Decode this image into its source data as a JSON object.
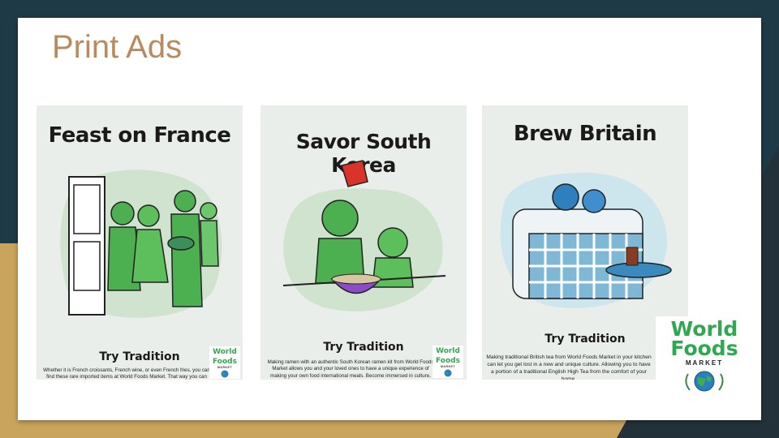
{
  "slide": {
    "title": "Print Ads"
  },
  "ads": [
    {
      "headline": "Feast on France",
      "subhead": "Try Tradition",
      "body": "Whether it is French croissants, French wine, or even French fries, you can find these rare imported items at World Foods Market. That way you can experience a Parisian family dinner without having to buy a plane ticket."
    },
    {
      "headline": "Savor South Korea",
      "subhead": "Try Tradition",
      "body": "Making ramen with an authentic South Korean ramen kit from World Foods Market allows you and your loved ones to have a unique experience of making your own food international meals. Become immersed in culture, without setting foot in South Korea."
    },
    {
      "headline": "Brew Britain",
      "subhead": "Try Tradition",
      "body": "Making traditional British tea from World Foods Market in your kitchen can let you get lost in a new and unique culture. Allowing you to have a portion of a traditional English High Tea from the comfort of your home."
    }
  ],
  "logo": {
    "word1": "World",
    "word2": "Foods",
    "tagline": "MARKET"
  },
  "colors": {
    "accent_title": "#b98a5e",
    "brand_green": "#2fa84f",
    "background_dark": "#1f3a47",
    "background_gold": "#c9a45c"
  }
}
